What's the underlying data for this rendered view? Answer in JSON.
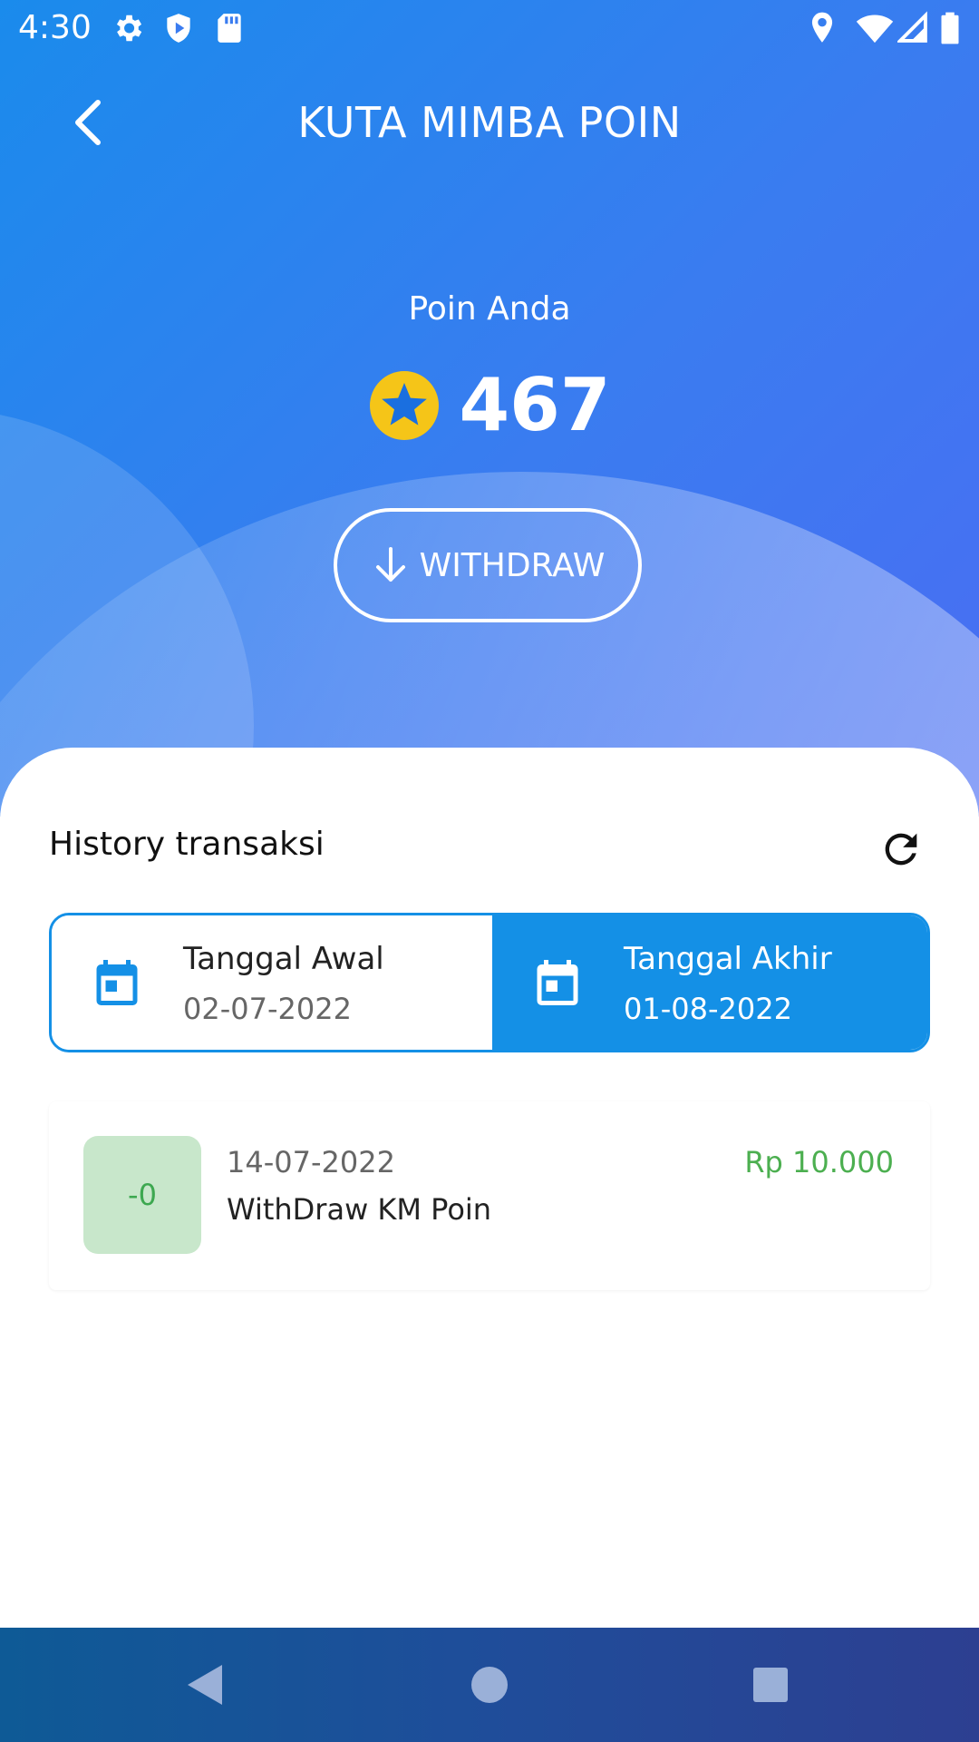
{
  "status_bar": {
    "time": "4:30",
    "left_icons": [
      "gear-icon",
      "shield-play-icon",
      "sd-card-icon"
    ],
    "right_icons": [
      "location-icon",
      "wifi-icon",
      "signal-icon",
      "battery-icon"
    ]
  },
  "header": {
    "title": "KUTA MIMBA POIN",
    "back_icon": "chevron-left-icon"
  },
  "points": {
    "label": "Poin Anda",
    "value": "467",
    "icon": "star-coin-icon"
  },
  "withdraw": {
    "label": "WITHDRAW",
    "icon": "arrow-down-icon"
  },
  "history": {
    "title": "History transaksi",
    "refresh_icon": "refresh-icon",
    "start_date": {
      "label": "Tanggal Awal",
      "value": "02-07-2022"
    },
    "end_date": {
      "label": "Tanggal Akhir",
      "value": "01-08-2022"
    },
    "transactions": [
      {
        "badge": "-0",
        "date": "14-07-2022",
        "description": "WithDraw KM Poin",
        "amount": "Rp 10.000"
      }
    ]
  },
  "nav": [
    "back-triangle-icon",
    "home-circle-icon",
    "recents-square-icon"
  ],
  "colors": {
    "primary": "#1490e6",
    "accent_yellow": "#f5c518",
    "success_green": "#4caf50",
    "badge_bg": "#c8e7cb"
  }
}
